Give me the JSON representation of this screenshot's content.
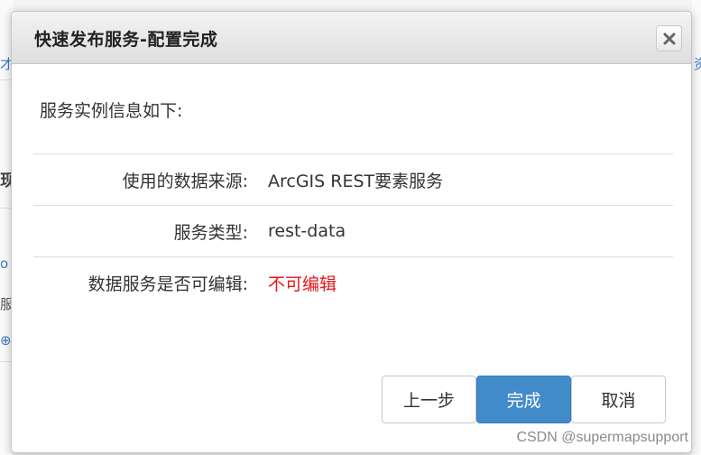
{
  "background": {
    "left_glyphs": [
      "才",
      "现",
      "o",
      "服",
      "⊕"
    ],
    "right_glyphs": [
      "资"
    ]
  },
  "dialog": {
    "title": "快速发布服务-配置完成",
    "close_symbol": "✖"
  },
  "content": {
    "intro": "服务实例信息如下:",
    "rows": [
      {
        "label": "使用的数据来源:",
        "value": "ArcGIS REST要素服务"
      },
      {
        "label": "服务类型:",
        "value": "rest-data"
      },
      {
        "label": "数据服务是否可编辑:",
        "value": "不可编辑"
      }
    ]
  },
  "buttons": {
    "prev": "上一步",
    "finish": "完成",
    "cancel": "取消"
  },
  "watermark": "CSDN @supermapsupport",
  "colors": {
    "primary": "#428bca",
    "warning": "#e8141b"
  }
}
